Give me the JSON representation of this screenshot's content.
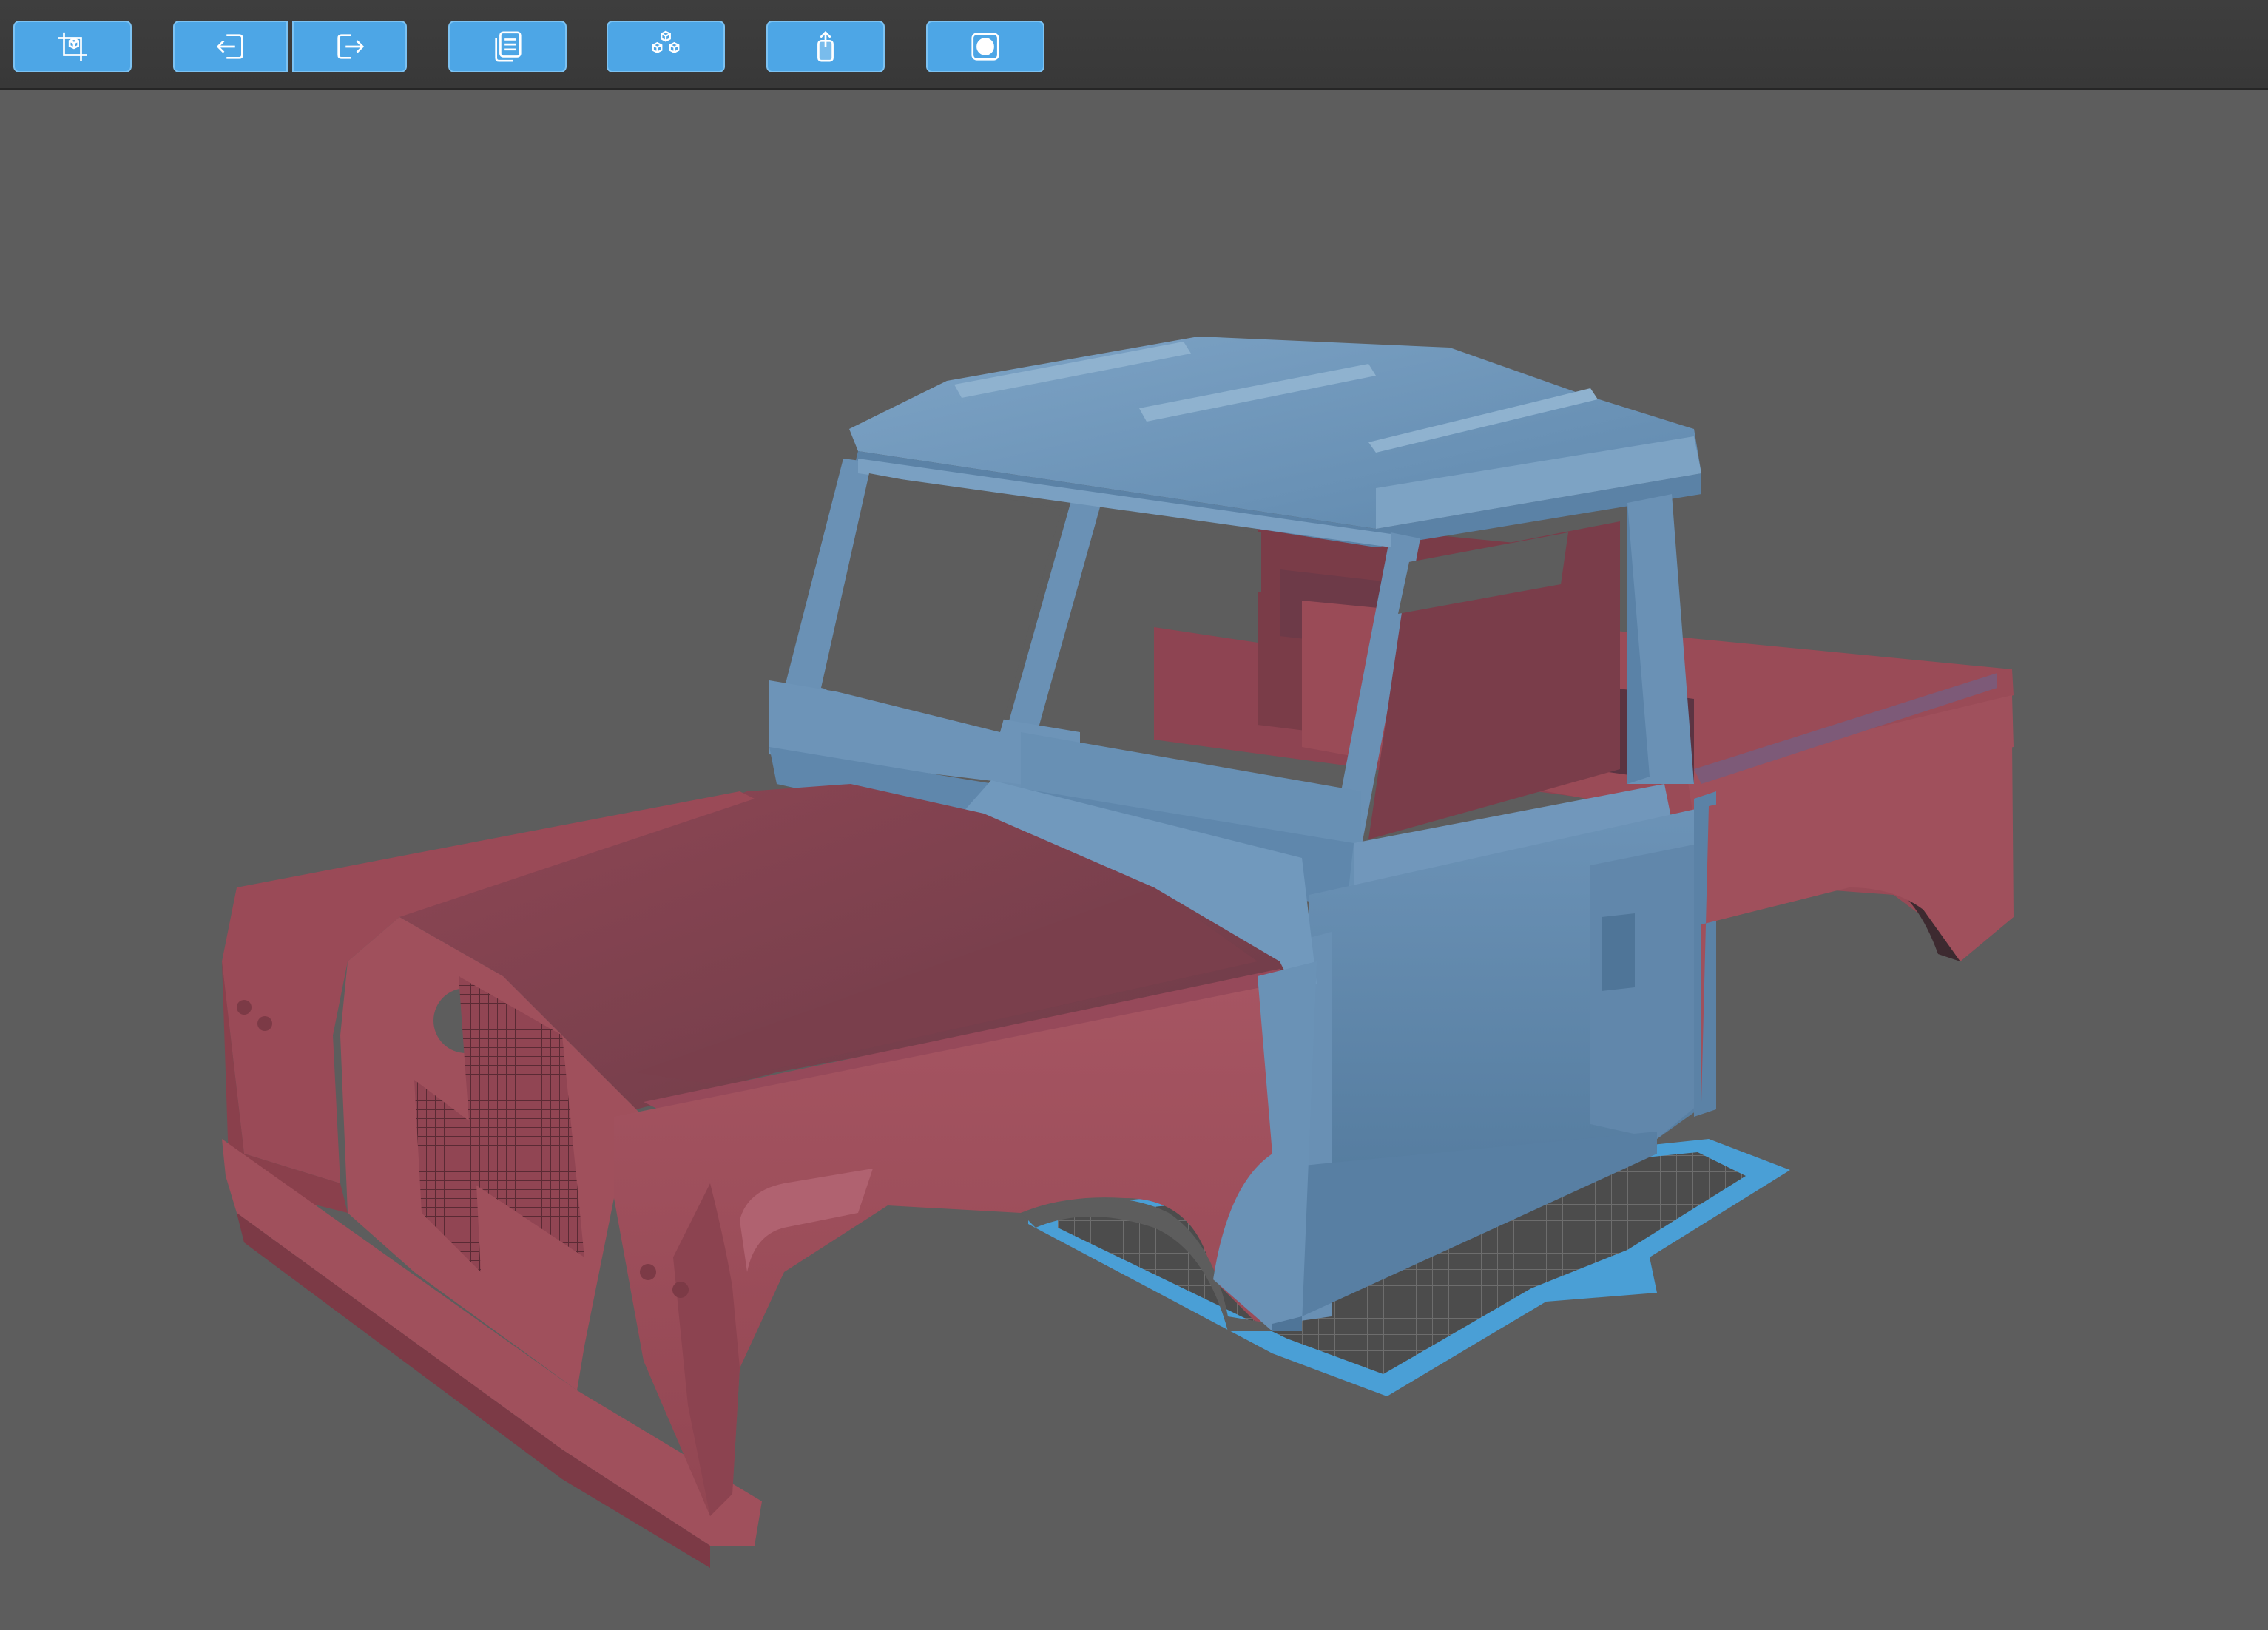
{
  "toolbar": {
    "buttons": [
      {
        "icon": "crop-icon"
      },
      {
        "icon": "import-icon"
      },
      {
        "icon": "export-icon"
      },
      {
        "icon": "document-icon"
      },
      {
        "icon": "parts-icon"
      },
      {
        "icon": "upload-icon"
      },
      {
        "icon": "record-icon"
      }
    ]
  },
  "colors": {
    "button": "#4da6e6",
    "toolbar": "#3b3b3b",
    "viewport": "#5d5d5d",
    "body_red": "#a0505c",
    "body_blue": "#6b93b8",
    "build_plate": "#4a9fd6"
  }
}
